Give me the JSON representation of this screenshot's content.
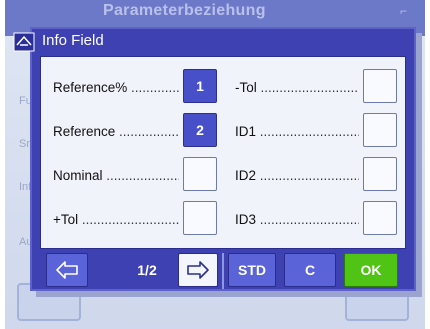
{
  "background": {
    "title": "Parameterbeziehung",
    "rows": [
      "Fu",
      "Sm",
      "Inf",
      "Au"
    ]
  },
  "dialog": {
    "title": "Info Field",
    "fields_left": [
      {
        "label": "Reference%",
        "value": "1",
        "selected": true
      },
      {
        "label": "Reference",
        "value": "2",
        "selected": true
      },
      {
        "label": "Nominal",
        "value": "",
        "selected": false
      },
      {
        "label": "+Tol",
        "value": "",
        "selected": false
      }
    ],
    "fields_right": [
      {
        "label": "-Tol",
        "value": "",
        "selected": false
      },
      {
        "label": "ID1",
        "value": "",
        "selected": false
      },
      {
        "label": "ID2",
        "value": "",
        "selected": false
      },
      {
        "label": "ID3",
        "value": "",
        "selected": false
      }
    ]
  },
  "toolbar": {
    "prev_icon": "arrow-left-icon",
    "page": "1/2",
    "next_icon": "arrow-right-icon",
    "std_label": "STD",
    "c_label": "C",
    "ok_label": "OK"
  },
  "colors": {
    "dialog_bg": "#3d41b2",
    "selected_box": "#4750c9",
    "ok_button": "#4fc414"
  }
}
